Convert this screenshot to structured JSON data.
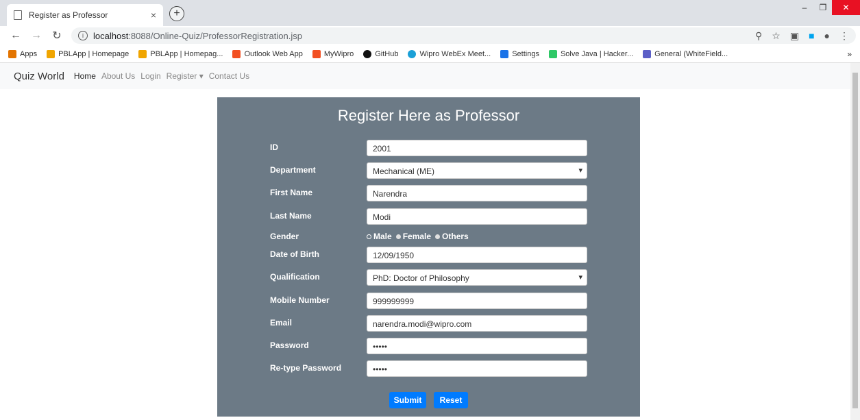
{
  "browser": {
    "tab_title": "Register as Professor",
    "tab_close": "×",
    "new_tab": "+",
    "url_host": "localhost",
    "url_path": ":8088/Online-Quiz/ProfessorRegistration.jsp",
    "bookmarks": [
      {
        "label": "Apps",
        "icon": "apps-grid-icon",
        "color": "#e37400"
      },
      {
        "label": "PBLApp | Homepage",
        "icon": "java-icon",
        "color": "#f0a500"
      },
      {
        "label": "PBLApp | Homepag...",
        "icon": "java-icon",
        "color": "#f0a500"
      },
      {
        "label": "Outlook Web App",
        "icon": "windows-icon",
        "color": "#f25022"
      },
      {
        "label": "MyWipro",
        "icon": "windows-icon",
        "color": "#f25022"
      },
      {
        "label": "GitHub",
        "icon": "github-icon",
        "color": "#111111"
      },
      {
        "label": "Wipro WebEx Meet...",
        "icon": "webex-icon",
        "color": "#1ba0d7"
      },
      {
        "label": "Settings",
        "icon": "gear-icon",
        "color": "#1a73e8"
      },
      {
        "label": "Solve Java | Hacker...",
        "icon": "hackerrank-icon",
        "color": "#2ec866"
      },
      {
        "label": "General (WhiteField...",
        "icon": "teams-icon",
        "color": "#5b5fc7"
      }
    ],
    "bookmarks_more": "»"
  },
  "navbar": {
    "brand": "Quiz World",
    "links": [
      "Home",
      "About Us",
      "Login",
      "Register ▾",
      "Contact Us"
    ]
  },
  "form": {
    "title": "Register Here as Professor",
    "id_label": "ID",
    "id_value": "2001",
    "department_label": "Department",
    "department_value": "Mechanical (ME)",
    "first_name_label": "First Name",
    "first_name_value": "Narendra",
    "last_name_label": "Last Name",
    "last_name_value": "Modi",
    "gender_label": "Gender",
    "gender_options": [
      "Male",
      "Female",
      "Others"
    ],
    "dob_label": "Date of Birth",
    "dob_value": "12/09/1950",
    "qualification_label": "Qualification",
    "qualification_value": "PhD: Doctor of Philosophy",
    "mobile_label": "Mobile Number",
    "mobile_value": "999999999",
    "email_label": "Email",
    "email_value": "narendra.modi@wipro.com",
    "password_label": "Password",
    "password_value": "•••••",
    "retype_label": "Re-type Password",
    "retype_value": "•••••",
    "submit_label": "Submit",
    "reset_label": "Reset"
  }
}
